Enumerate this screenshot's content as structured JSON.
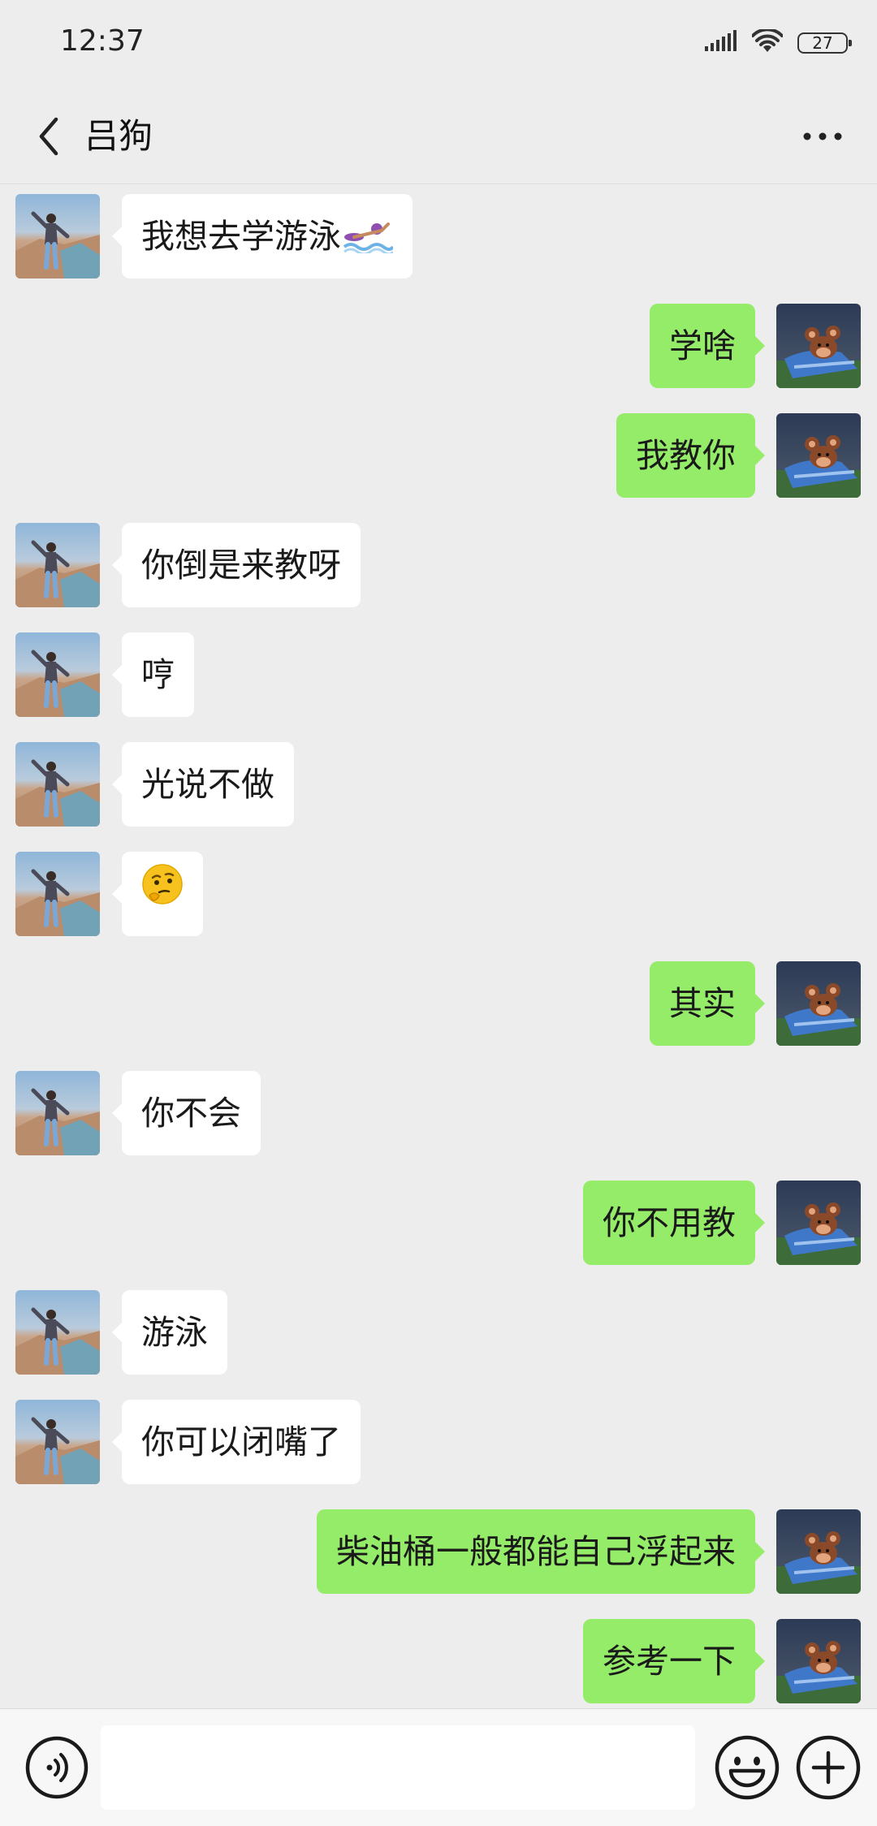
{
  "status_bar": {
    "time": "12:37",
    "battery": "27"
  },
  "header": {
    "title": "吕狗",
    "back_icon": "back-chevron-icon",
    "more_icon": "more-dots-icon"
  },
  "messages": [
    {
      "side": "in",
      "text": "我想去学游泳",
      "emoji": "swimmer"
    },
    {
      "side": "out",
      "text": "学啥"
    },
    {
      "side": "out",
      "text": "我教你"
    },
    {
      "side": "in",
      "text": "你倒是来教呀"
    },
    {
      "side": "in",
      "text": "哼"
    },
    {
      "side": "in",
      "text": "光说不做"
    },
    {
      "side": "in",
      "text": "",
      "emoji": "thinking-face"
    },
    {
      "side": "out",
      "text": "其实"
    },
    {
      "side": "in",
      "text": "你不会"
    },
    {
      "side": "out",
      "text": "你不用教"
    },
    {
      "side": "in",
      "text": "游泳"
    },
    {
      "side": "in",
      "text": "你可以闭嘴了"
    },
    {
      "side": "out",
      "text": "柴油桶一般都能自己浮起来"
    },
    {
      "side": "out",
      "text": "参考一下"
    }
  ],
  "input_bar": {
    "value": "",
    "voice_icon": "voice-icon",
    "emoji_icon": "emoji-icon",
    "plus_icon": "plus-icon"
  },
  "colors": {
    "background": "#EDEDED",
    "incoming_bubble": "#FFFFFF",
    "outgoing_bubble": "#95EC69",
    "input_bar": "#F7F7F7"
  }
}
